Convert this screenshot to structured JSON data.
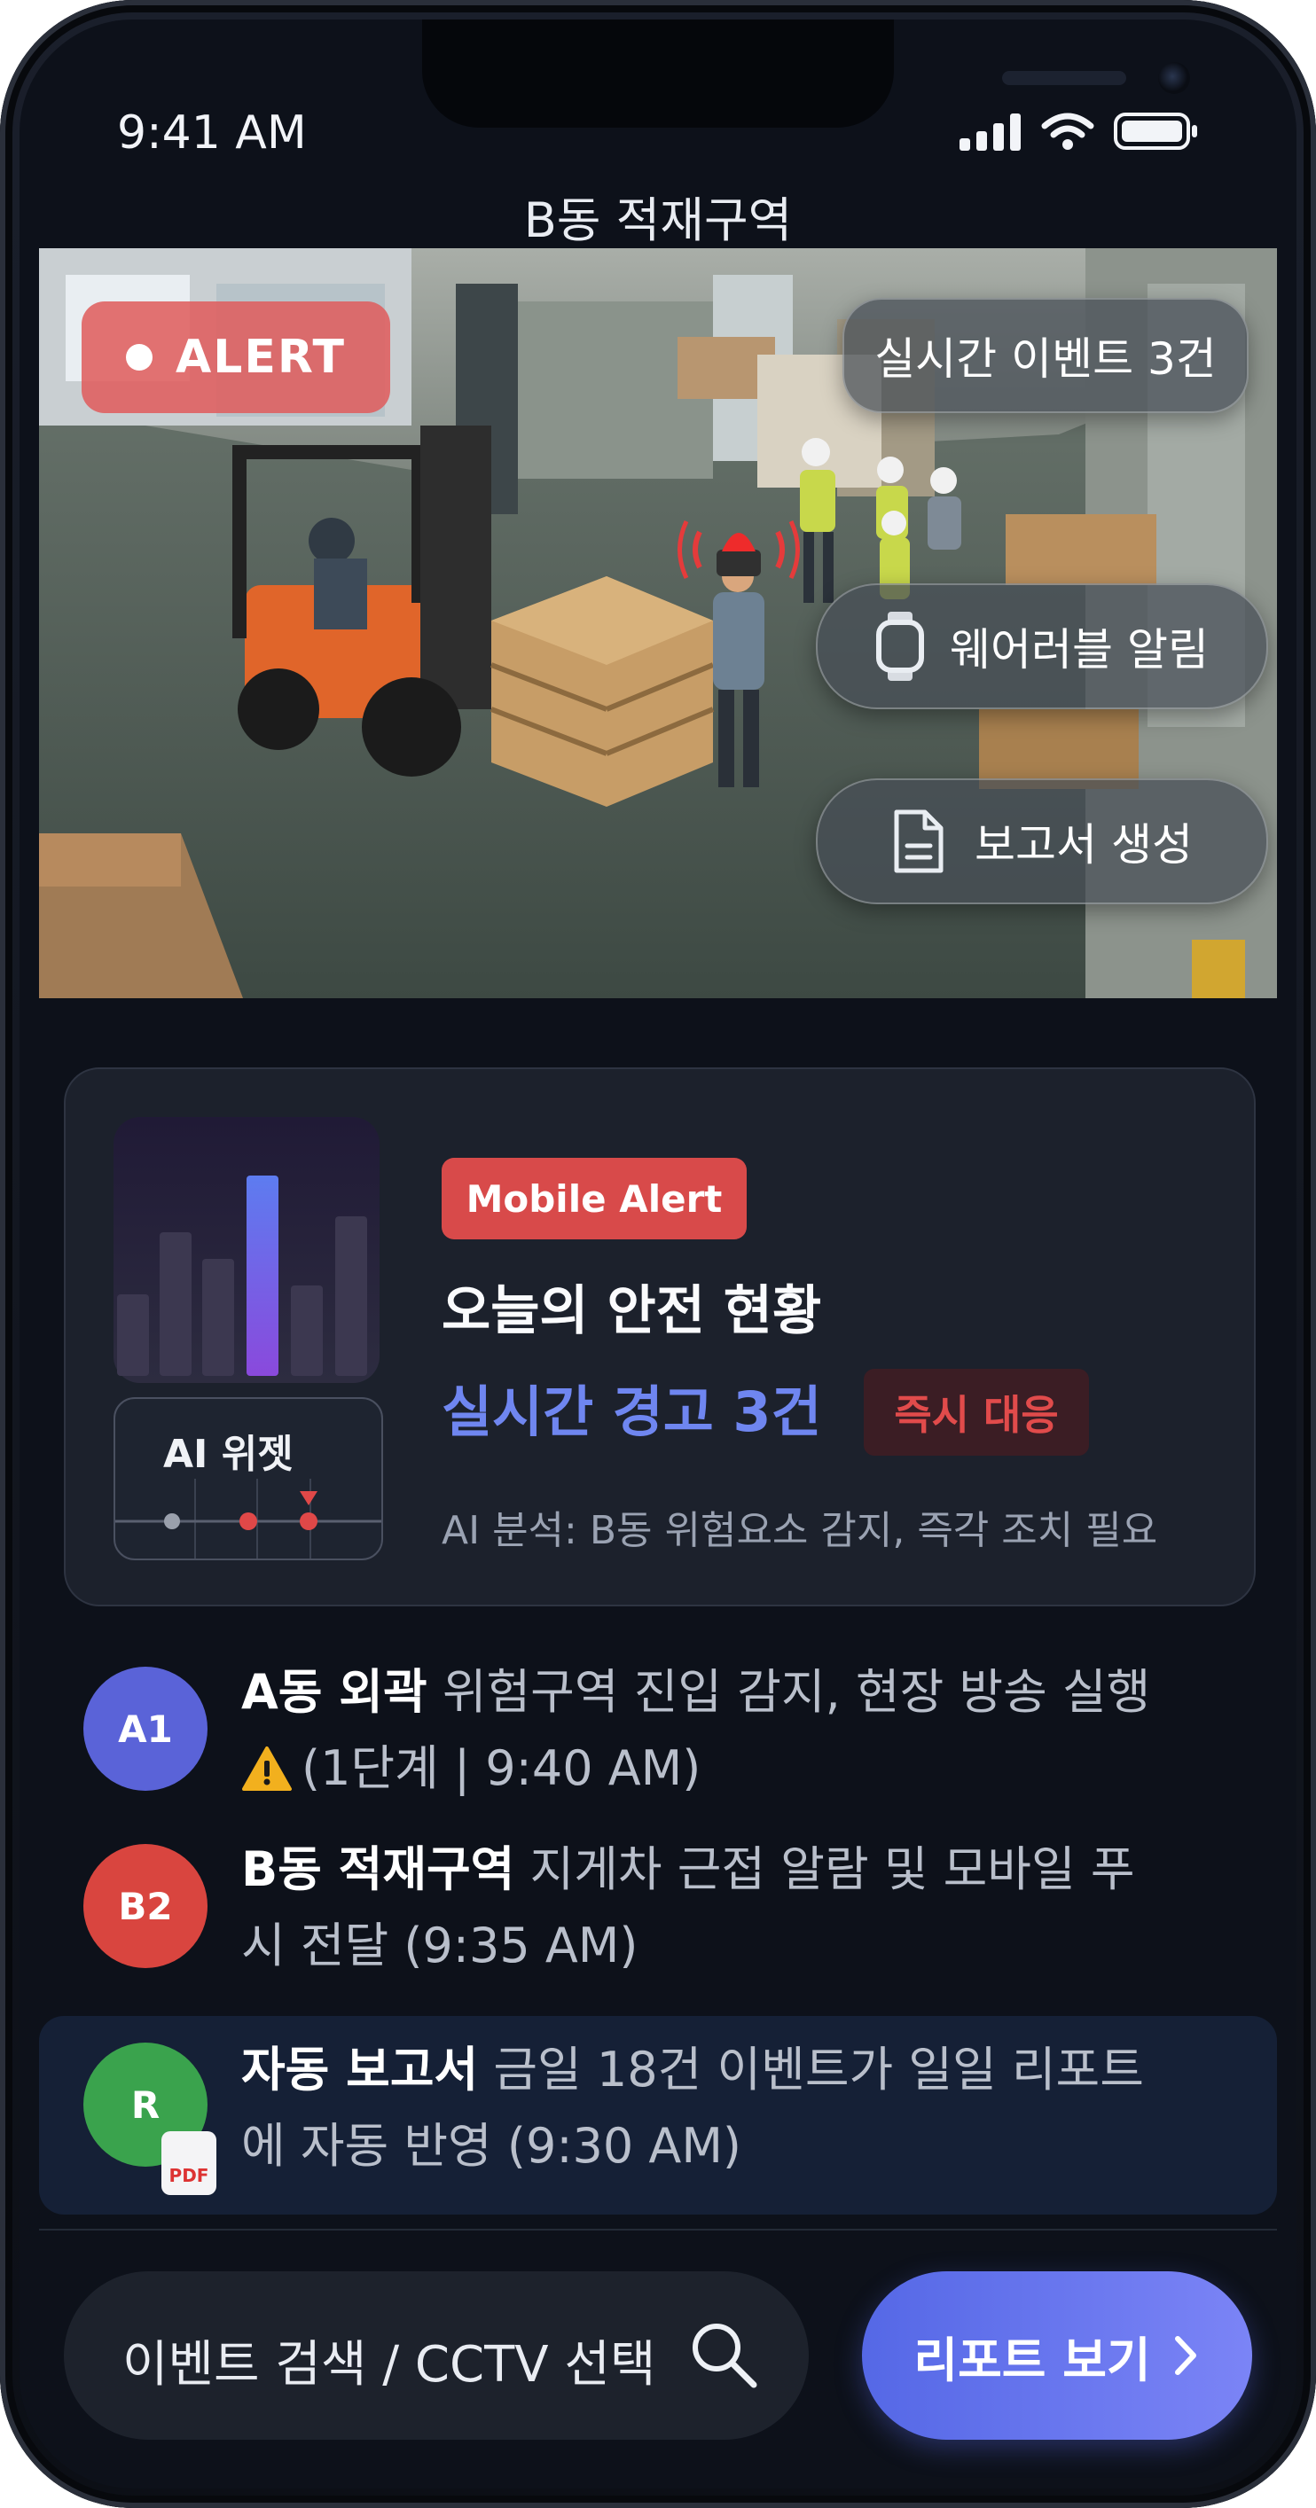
{
  "status_bar": {
    "time": "9:41 AM"
  },
  "header": {
    "title": "B동 적재구역"
  },
  "camera": {
    "alert_label": "ALERT",
    "events_label": "실시간 이벤트 3건",
    "wearable_label": "웨어러블 알림",
    "report_label": "보고서 생성"
  },
  "card": {
    "widget_label": "AI 위젯",
    "badge": "Mobile Alert",
    "heading": "오늘의 안전 현황",
    "count_text": "실시간 경고 3건",
    "urgent_badge": "즉시 대응",
    "analysis": "AI 분석: B동 위험요소 감지, 즉각 조치 필요"
  },
  "feed": [
    {
      "avatar": "A1",
      "title": "A동 외곽",
      "line1": "위험구역 진입 감지, 현장 방송 실행",
      "line2": "(1단계 | 9:40 AM)",
      "color": "#5a63d8"
    },
    {
      "avatar": "B2",
      "title": "B동 적재구역",
      "line1": "지게차 근접 알람 및 모바일 푸",
      "line2": "시 전달 (9:35 AM)",
      "color": "#d9453f"
    },
    {
      "avatar": "R",
      "title": "자동 보고서",
      "line1": "금일 18건 이벤트가 일일 리포트",
      "line2": "에 자동 반영 (9:30 AM)",
      "color": "#3aa34d",
      "file_badge": "PDF"
    }
  ],
  "bottom": {
    "search_text": "이벤트 검색 / CCTV 선택",
    "report_button": "리포트 보기"
  },
  "colors": {
    "accent": "#6f86f0",
    "alert": "#d84a4a",
    "background": "#0d111a"
  }
}
